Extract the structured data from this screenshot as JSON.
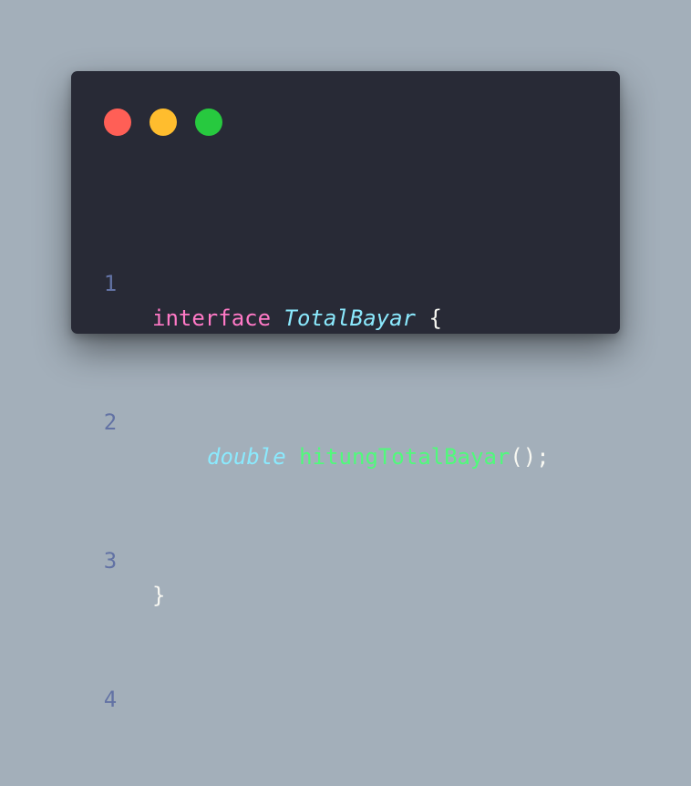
{
  "colors": {
    "background": "#a3afba",
    "window": "#282a36",
    "close": "#ff5f56",
    "minimize": "#ffbd2e",
    "maximize": "#27c93f",
    "line_number": "#6272a4",
    "keyword": "#ff79c6",
    "type_name": "#8be9fd",
    "method": "#50fa7b",
    "plain": "#f8f8f2"
  },
  "window_controls": [
    "close-button",
    "minimize-button",
    "maximize-button"
  ],
  "code": {
    "lines": [
      {
        "number": "1",
        "tokens": {
          "keyword": "interface",
          "type_name": "TotalBayar",
          "brace_open": "{"
        }
      },
      {
        "number": "2",
        "tokens": {
          "return_type": "double",
          "method_name": "hitungTotalBayar",
          "punct": "();"
        }
      },
      {
        "number": "3",
        "tokens": {
          "brace_close": "}"
        }
      },
      {
        "number": "4",
        "tokens": {}
      }
    ]
  }
}
